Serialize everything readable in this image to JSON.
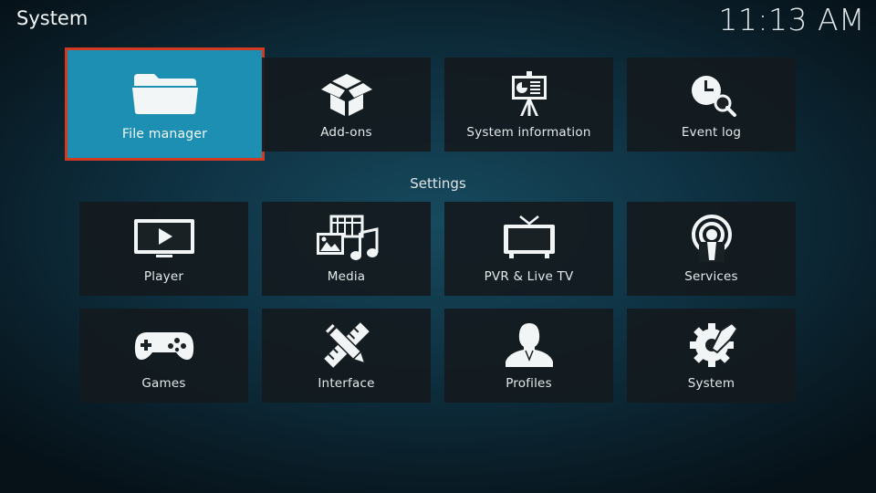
{
  "header": {
    "title": "System",
    "clock": "11:13 AM"
  },
  "top_row": [
    {
      "label": "File manager",
      "icon": "folder-icon"
    },
    {
      "label": "Add-ons",
      "icon": "open-box-icon"
    },
    {
      "label": "System information",
      "icon": "presentation-board-icon"
    },
    {
      "label": "Event log",
      "icon": "clock-search-icon"
    }
  ],
  "settings": {
    "title": "Settings",
    "items": [
      {
        "label": "Player",
        "icon": "play-screen-icon"
      },
      {
        "label": "Media",
        "icon": "media-film-music-icon"
      },
      {
        "label": "PVR & Live TV",
        "icon": "tv-antenna-icon"
      },
      {
        "label": "Services",
        "icon": "podcast-broadcast-icon"
      },
      {
        "label": "Games",
        "icon": "gamepad-icon"
      },
      {
        "label": "Interface",
        "icon": "pencil-ruler-icon"
      },
      {
        "label": "Profiles",
        "icon": "person-silhouette-icon"
      },
      {
        "label": "System",
        "icon": "gear-wrench-icon"
      }
    ]
  },
  "colors": {
    "focus_bg": "#1d8fb3",
    "focus_border": "#d23a22",
    "tile_bg": "#1a2125"
  }
}
